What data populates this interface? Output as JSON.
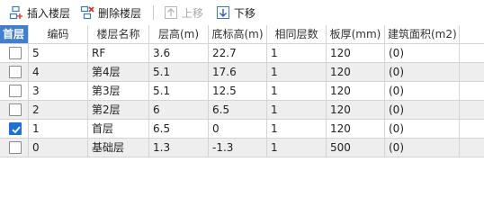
{
  "toolbar": {
    "insert_label": "插入楼层",
    "delete_label": "删除楼层",
    "up_label": "上移",
    "down_label": "下移"
  },
  "table": {
    "headers": [
      "首层",
      "编码",
      "楼层名称",
      "层高(m)",
      "底标高(m)",
      "相同层数",
      "板厚(mm)",
      "建筑面积(m2)"
    ],
    "rows": [
      {
        "first": false,
        "code": "5",
        "name": "RF",
        "height": "3.6",
        "elev": "22.7",
        "same": "1",
        "thick": "120",
        "area": "(0)"
      },
      {
        "first": false,
        "code": "4",
        "name": "第4层",
        "height": "5.1",
        "elev": "17.6",
        "same": "1",
        "thick": "120",
        "area": "(0)"
      },
      {
        "first": false,
        "code": "3",
        "name": "第3层",
        "height": "5.1",
        "elev": "12.5",
        "same": "1",
        "thick": "120",
        "area": "(0)"
      },
      {
        "first": false,
        "code": "2",
        "name": "第2层",
        "height": "6",
        "elev": "6.5",
        "same": "1",
        "thick": "120",
        "area": "(0)"
      },
      {
        "first": true,
        "code": "1",
        "name": "首层",
        "height": "6.5",
        "elev": "0",
        "same": "1",
        "thick": "120",
        "area": "(0)"
      },
      {
        "first": false,
        "code": "0",
        "name": "基础层",
        "height": "1.3",
        "elev": "-1.3",
        "same": "1",
        "thick": "500",
        "area": "(0)"
      }
    ]
  },
  "colors": {
    "header_accent": "#3f7fcf",
    "checkbox_checked": "#1e6fd8",
    "row_alt": "#eeeeee"
  }
}
